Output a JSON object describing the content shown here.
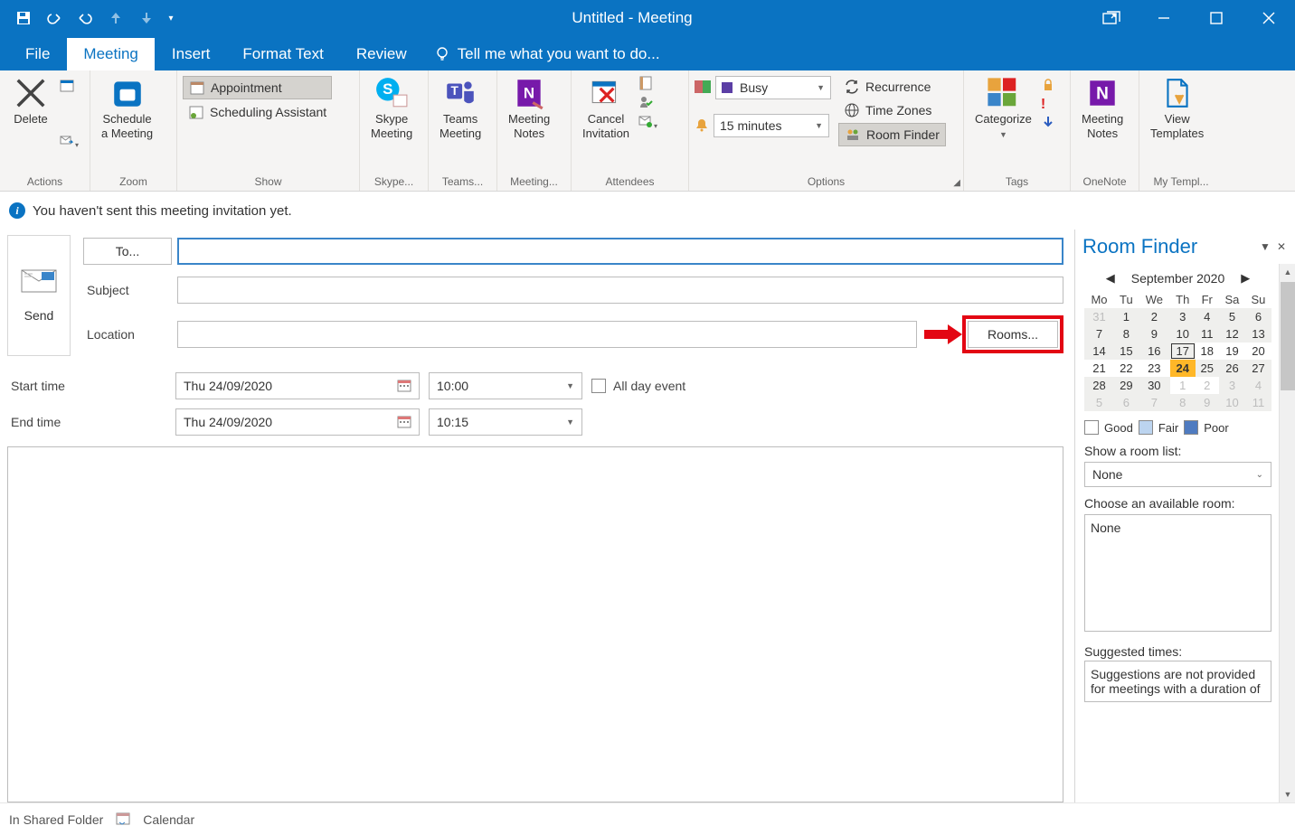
{
  "window": {
    "title": "Untitled - Meeting"
  },
  "tabs": {
    "file": "File",
    "meeting": "Meeting",
    "insert": "Insert",
    "format": "Format Text",
    "review": "Review",
    "tellme": "Tell me what you want to do..."
  },
  "ribbon": {
    "actions": {
      "delete": "Delete",
      "label": "Actions"
    },
    "zoom": {
      "schedule": "Schedule\na Meeting",
      "label": "Zoom"
    },
    "show": {
      "appointment": "Appointment",
      "scheduling": "Scheduling Assistant",
      "label": "Show"
    },
    "skype": {
      "btn": "Skype\nMeeting",
      "label": "Skype..."
    },
    "teams": {
      "btn": "Teams\nMeeting",
      "label": "Teams..."
    },
    "meetingnotes": {
      "btn": "Meeting\nNotes",
      "label": "Meeting..."
    },
    "attendees": {
      "cancel": "Cancel\nInvitation",
      "label": "Attendees"
    },
    "options": {
      "busy": "Busy",
      "reminder": "15 minutes",
      "recurrence": "Recurrence",
      "timezones": "Time Zones",
      "roomfinder": "Room Finder",
      "label": "Options"
    },
    "tags": {
      "categorize": "Categorize",
      "label": "Tags"
    },
    "onenote": {
      "btn": "Meeting\nNotes",
      "label": "OneNote"
    },
    "templates": {
      "btn": "View\nTemplates",
      "label": "My Templ..."
    }
  },
  "infobar": {
    "text": "You haven't sent this meeting invitation yet."
  },
  "form": {
    "send": "Send",
    "to": "To...",
    "subject": "Subject",
    "location": "Location",
    "rooms": "Rooms...",
    "starttime": "Start time",
    "endtime": "End time",
    "startdate": "Thu 24/09/2020",
    "enddate": "Thu 24/09/2020",
    "startclock": "10:00",
    "endclock": "10:15",
    "allday": "All day event"
  },
  "status": {
    "folder": "In Shared Folder",
    "calendar": "Calendar"
  },
  "roomfinder": {
    "title": "Room Finder",
    "month": "September 2020",
    "dow": [
      "Mo",
      "Tu",
      "We",
      "Th",
      "Fr",
      "Sa",
      "Su"
    ],
    "weeks": [
      [
        {
          "d": "31",
          "dim": true,
          "out": true
        },
        {
          "d": "1",
          "out": true
        },
        {
          "d": "2",
          "out": true
        },
        {
          "d": "3",
          "out": true
        },
        {
          "d": "4",
          "out": true
        },
        {
          "d": "5",
          "out": true
        },
        {
          "d": "6",
          "out": true
        }
      ],
      [
        {
          "d": "7",
          "out": true
        },
        {
          "d": "8",
          "out": true
        },
        {
          "d": "9",
          "out": true
        },
        {
          "d": "10",
          "out": true
        },
        {
          "d": "11",
          "out": true
        },
        {
          "d": "12",
          "out": true
        },
        {
          "d": "13",
          "out": true
        }
      ],
      [
        {
          "d": "14",
          "out": true
        },
        {
          "d": "15",
          "out": true
        },
        {
          "d": "16",
          "out": true
        },
        {
          "d": "17",
          "out": true,
          "sel": true
        },
        {
          "d": "18"
        },
        {
          "d": "19"
        },
        {
          "d": "20"
        }
      ],
      [
        {
          "d": "21"
        },
        {
          "d": "22"
        },
        {
          "d": "23"
        },
        {
          "d": "24",
          "today": true
        },
        {
          "d": "25",
          "out": true
        },
        {
          "d": "26",
          "out": true
        },
        {
          "d": "27",
          "out": true
        }
      ],
      [
        {
          "d": "28",
          "out": true
        },
        {
          "d": "29",
          "out": true
        },
        {
          "d": "30",
          "out": true
        },
        {
          "d": "1",
          "dim": true
        },
        {
          "d": "2",
          "dim": true
        },
        {
          "d": "3",
          "dim": true,
          "out": true
        },
        {
          "d": "4",
          "dim": true,
          "out": true
        }
      ],
      [
        {
          "d": "5",
          "dim": true,
          "out": true
        },
        {
          "d": "6",
          "dim": true,
          "out": true
        },
        {
          "d": "7",
          "dim": true,
          "out": true
        },
        {
          "d": "8",
          "dim": true,
          "out": true
        },
        {
          "d": "9",
          "dim": true,
          "out": true
        },
        {
          "d": "10",
          "dim": true,
          "out": true
        },
        {
          "d": "11",
          "dim": true,
          "out": true
        }
      ]
    ],
    "legend": {
      "good": "Good",
      "fair": "Fair",
      "poor": "Poor"
    },
    "showlist": "Show a room list:",
    "listval": "None",
    "choose": "Choose an available room:",
    "chooseval": "None",
    "suggested": "Suggested times:",
    "suggtext": "Suggestions are not provided for meetings with a duration of"
  }
}
